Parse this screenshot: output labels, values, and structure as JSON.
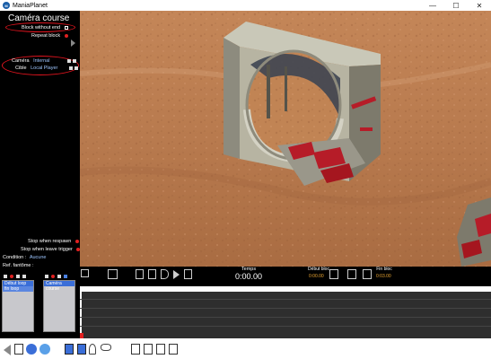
{
  "window": {
    "title": "ManiaPlanet",
    "controls": [
      "—",
      "☐",
      "✕"
    ]
  },
  "panel": {
    "title": "Caméra course",
    "block_without_end": "Block without end",
    "repeat_block": "Repeat block",
    "camera_label": "Caméra",
    "camera_value": "Internal",
    "target_label": "Cible",
    "target_value": "Local Player",
    "stop_when_respawn": "Stop when respawn",
    "stop_when_leave_trigger": "Stop when leave trigger",
    "condition_label": "Condition :",
    "condition_value": "Aucune",
    "ref_fantome_label": "Ref. fantôme :"
  },
  "timeline": {
    "temps_label": "Temps",
    "temps_value": "0:00.00",
    "debut_bloc_label": "Début bloc",
    "debut_bloc_value": "0:00.00",
    "fin_bloc_label": "Fin bloc",
    "fin_bloc_value": "0:03.00",
    "list_left": [
      "Début loop",
      "fin loop"
    ],
    "list_right": [
      "Caméra course"
    ]
  },
  "colors": {
    "highlight": "#e0141e",
    "accent_blue": "#9ec6ff",
    "orange": "#e8a432",
    "selected": "#3a6ed8"
  }
}
